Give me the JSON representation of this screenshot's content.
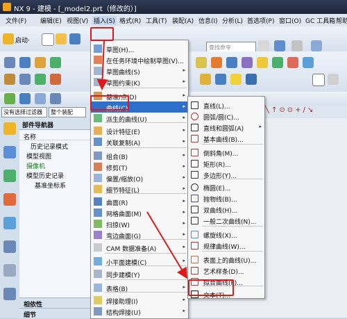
{
  "titlebar": {
    "text": "NX 9 - 建模 - [_model2.prt（修改的）]"
  },
  "menubar": {
    "items": [
      "文件(F)",
      "编辑(E)",
      "视图(V)",
      "插入(S)",
      "格式(R)",
      "工具(T)",
      "装配(A)",
      "信息(I)",
      "分析(L)",
      "首选项(P)",
      "窗口(O)",
      "GC 工具箱",
      "帮助"
    ]
  },
  "toolbar": {
    "start_label": "启动·",
    "search_placeholder": "查找命令"
  },
  "filter_bar": {
    "filter_label": "没有选择过滤器",
    "assembly_label": "整个装配"
  },
  "navigator": {
    "title": "部件导航器",
    "col_name": "名称",
    "nodes": [
      "历史记录模式",
      "模型视图",
      "摄像机",
      "模型历史记录",
      "基准坐标系"
    ],
    "footer_dep": "相依性",
    "footer_detail": "细节"
  },
  "insert_menu": {
    "items": [
      {
        "label": "草图(H)...",
        "arrow": ""
      },
      {
        "label": "在任务环境中绘制草图(V)...",
        "arrow": ""
      },
      {
        "label": "草图曲线(S)",
        "arrow": "▸"
      },
      {
        "label": "草图约束(K)",
        "arrow": "▸"
      },
      {
        "label": "基准/点(D)",
        "arrow": "▸"
      },
      {
        "label": "曲线(C)",
        "arrow": "▸"
      },
      {
        "label": "派生的曲线(U)",
        "arrow": "▸"
      },
      {
        "label": "设计特征(E)",
        "arrow": "▸"
      },
      {
        "label": "关联复制(A)",
        "arrow": "▸"
      },
      {
        "label": "组合(B)",
        "arrow": "▸"
      },
      {
        "label": "修剪(T)",
        "arrow": "▸"
      },
      {
        "label": "偏置/缩放(O)",
        "arrow": "▸"
      },
      {
        "label": "细节特征(L)",
        "arrow": "▸"
      },
      {
        "label": "曲面(R)",
        "arrow": "▸"
      },
      {
        "label": "网格曲面(M)",
        "arrow": "▸"
      },
      {
        "label": "扫掠(W)",
        "arrow": "▸"
      },
      {
        "label": "弯边曲面(G)",
        "arrow": "▸"
      },
      {
        "label": "CAM 数据准备(A)",
        "arrow": "▸"
      },
      {
        "label": "小平面建模(C)",
        "arrow": "▸"
      },
      {
        "label": "同步建模(Y)",
        "arrow": "▸"
      },
      {
        "label": "表格(B)",
        "arrow": "▸"
      },
      {
        "label": "焊接助理(I)",
        "arrow": "▸"
      },
      {
        "label": "结构焊接(U)",
        "arrow": "▸"
      }
    ]
  },
  "curve_menu": {
    "items": [
      {
        "label": "直线(L)...",
        "arrow": ""
      },
      {
        "label": "圆弧/圆(C)...",
        "arrow": ""
      },
      {
        "label": "直线和圆弧(A)",
        "arrow": "▸"
      },
      {
        "label": "基本曲线(B)...",
        "arrow": ""
      },
      {
        "label": "倒斜角(M)...",
        "arrow": ""
      },
      {
        "label": "矩形(R)...",
        "arrow": ""
      },
      {
        "label": "多边形(Y)...",
        "arrow": ""
      },
      {
        "label": "椭圆(E)...",
        "arrow": ""
      },
      {
        "label": "抛物线(B)...",
        "arrow": ""
      },
      {
        "label": "双曲线(H)...",
        "arrow": ""
      },
      {
        "label": "一般二次曲线(N)...",
        "arrow": ""
      },
      {
        "label": "螺旋线(X)...",
        "arrow": ""
      },
      {
        "label": "规律曲线(W)...",
        "arrow": ""
      },
      {
        "label": "表面上的曲线(U)...",
        "arrow": ""
      },
      {
        "label": "艺术样条(D)...",
        "arrow": ""
      },
      {
        "label": "拟合曲线(F)...",
        "arrow": ""
      },
      {
        "label": "文本(T)...",
        "arrow": ""
      }
    ]
  },
  "colors": {
    "highlight": "#2f6fcc",
    "annotation": "#e01818"
  }
}
